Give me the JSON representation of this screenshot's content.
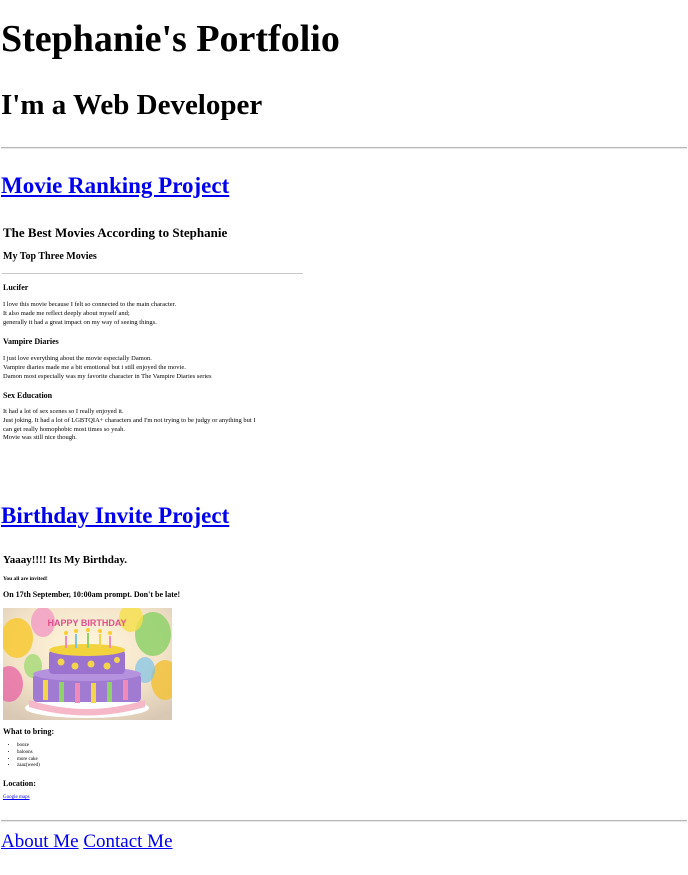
{
  "header": {
    "title": "Stephanie's Portfolio",
    "subtitle": "I'm a Web Developer"
  },
  "projects": {
    "movie": {
      "link_label": "Movie Ranking Project",
      "heading": "The Best Movies According to Stephanie",
      "subheading": "My Top Three Movies",
      "items": [
        {
          "title": "Lucifer",
          "lines": [
            "I love this movie because I felt so connected to the main character.",
            "It also made me reflect deeply about myself and;",
            "generally it had a great impact on my way of seeing things."
          ]
        },
        {
          "title": "Vampire Diaries",
          "lines": [
            "I just love everything about the movie especially Damon.",
            "Vampire diaries made me a bit emotional but i still enjoyed the movie.",
            "Damon most especially was my favorite character in The Vampire Diaries series"
          ]
        },
        {
          "title": "Sex Education",
          "lines": [
            "It had a lot of sex scenes so I really enjoyed it.",
            "Just joking. It had a lot of LGBTQIA+ characters and I'm not trying to be judgy or anything but I",
            "can get really homophobic most times so yeah.",
            "Movie was still nice though."
          ]
        }
      ]
    },
    "birthday": {
      "link_label": "Birthday Invite Project",
      "heading": "Yaaay!!!! Its My Birthday.",
      "invited": "You all are invited!",
      "when": "On 17th September, 10:00am prompt. Don't be late!",
      "cake_text": "HAPPY BIRTHDAY",
      "bring_heading": "What to bring:",
      "bring_items": [
        "booze",
        "baloons",
        "more cake",
        "zaaz(weed)"
      ],
      "location_heading": "Location:",
      "maps_link": "Google maps"
    }
  },
  "footer": {
    "about": "About Me",
    "contact": "Contact Me"
  },
  "colors": {
    "link": "#0000ee",
    "text": "#000000",
    "background": "#ffffff"
  }
}
